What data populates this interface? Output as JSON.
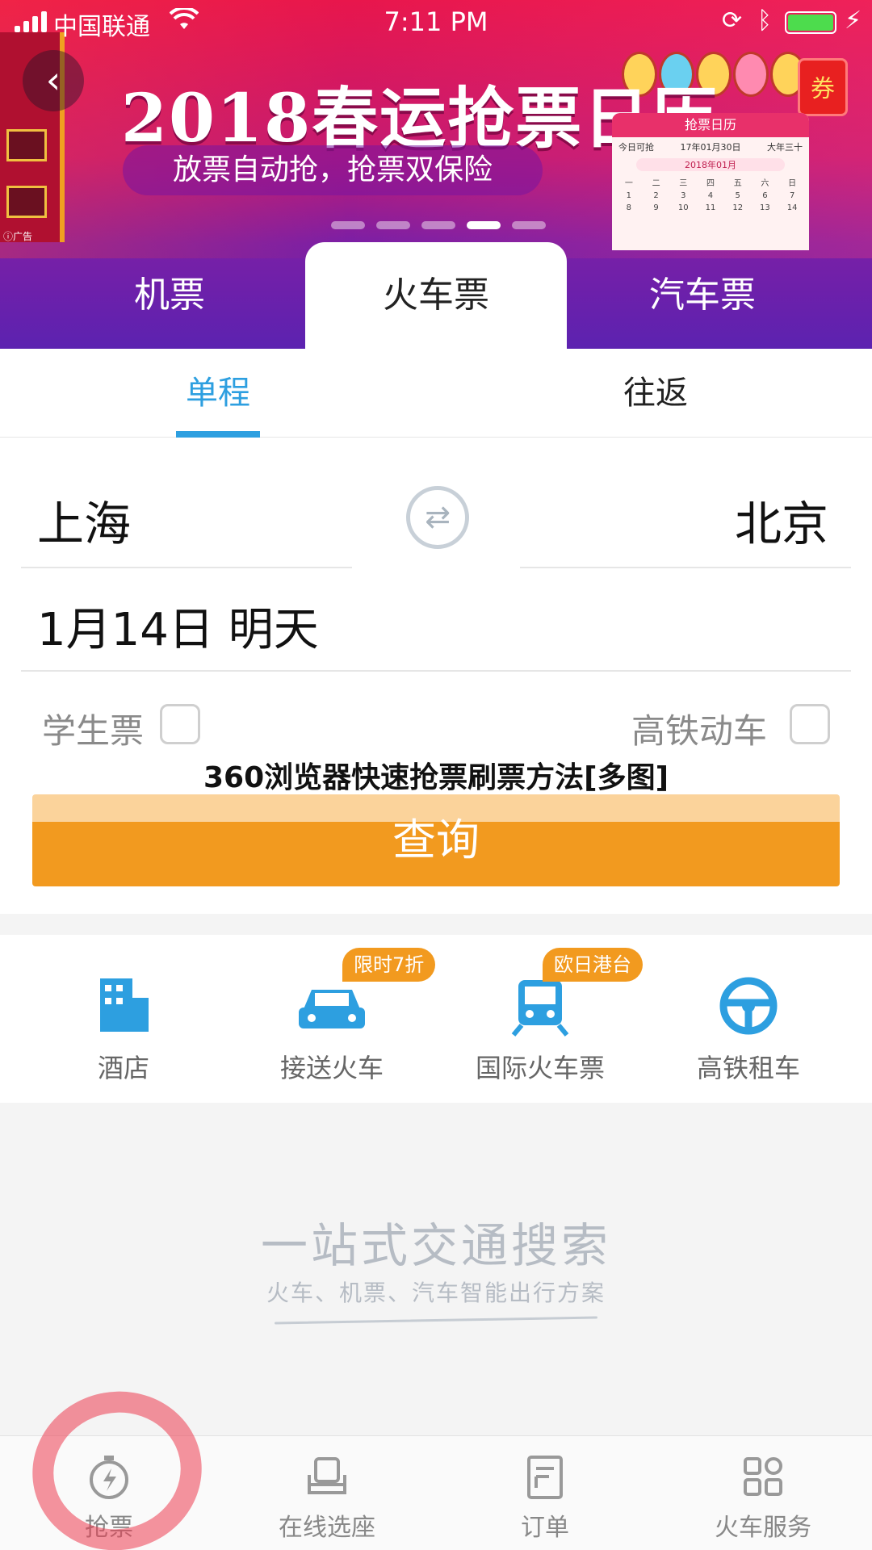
{
  "status_bar": {
    "carrier": "中国联通",
    "time": "7:11 PM"
  },
  "banner": {
    "title": "2018春运抢票日历",
    "subtitle": "放票自动抢，抢票双保险",
    "ad_label": "广告",
    "coupon": "券",
    "calendar": {
      "header": "抢票日历",
      "today_label": "今日可抢",
      "sale_date": "17年01月30日",
      "lunar": "大年三十",
      "month": "2018年01月",
      "weekdays": [
        "一",
        "二",
        "三",
        "四",
        "五",
        "六",
        "日"
      ],
      "days": [
        "1",
        "2",
        "3",
        "4",
        "5",
        "6",
        "7",
        "8",
        "9",
        "10",
        "11",
        "12",
        "13",
        "14"
      ]
    },
    "page_count": 5,
    "active_page": 4
  },
  "mode_tabs": [
    {
      "label": "机票",
      "active": false
    },
    {
      "label": "火车票",
      "active": true
    },
    {
      "label": "汽车票",
      "active": false
    }
  ],
  "trip_tabs": [
    {
      "label": "单程",
      "active": true
    },
    {
      "label": "往返",
      "active": false
    }
  ],
  "form": {
    "from_city": "上海",
    "to_city": "北京",
    "swap_icon": "swap-arrows-icon",
    "date": "1月14日 明天",
    "student_label": "学生票",
    "student_checked": false,
    "highspeed_label": "高铁动车",
    "highspeed_checked": false,
    "query_button": "查询"
  },
  "overlay_title": "360浏览器快速抢票刷票方法[多图]",
  "services": [
    {
      "label": "酒店",
      "icon": "hotel-building-icon",
      "tag": ""
    },
    {
      "label": "接送火车",
      "icon": "car-icon",
      "tag": "限时7折"
    },
    {
      "label": "国际火车票",
      "icon": "train-icon",
      "tag": "欧日港台"
    },
    {
      "label": "高铁租车",
      "icon": "steering-wheel-icon",
      "tag": ""
    }
  ],
  "slogan": {
    "main": "一站式交通搜索",
    "sub": "火车、机票、汽车智能出行方案"
  },
  "bottom_nav": [
    {
      "label": "抢票",
      "icon": "stopwatch-bolt-icon"
    },
    {
      "label": "在线选座",
      "icon": "seat-icon"
    },
    {
      "label": "订单",
      "icon": "order-document-icon"
    },
    {
      "label": "火车服务",
      "icon": "grid-apps-icon"
    }
  ],
  "colors": {
    "accent_blue": "#2d9fe0",
    "query_orange": "#f29a1f",
    "banner_pink": "#e8164c",
    "banner_purple": "#5c22b0"
  }
}
